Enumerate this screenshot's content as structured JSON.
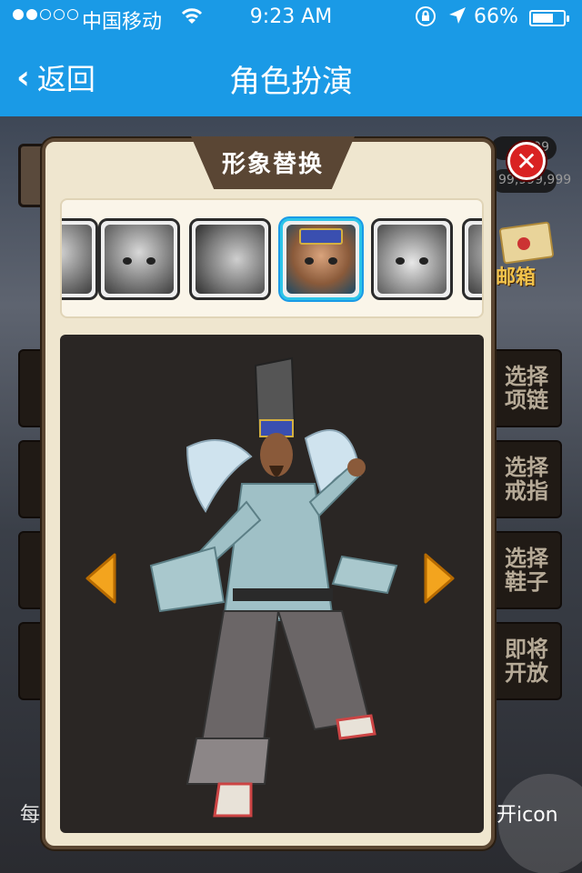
{
  "status_bar": {
    "signal_dots_on": 2,
    "signal_dots_total": 5,
    "carrier": "中国移动",
    "time": "9:23 AM",
    "battery_percent": "66%",
    "battery_level": 0.66
  },
  "nav": {
    "back_label": "返回",
    "title": "角色扮演"
  },
  "background": {
    "stat_values": [
      "999",
      "99,999,999"
    ],
    "mail_label": "邮箱",
    "side_buttons": [
      "选择\n项链",
      "选择\n戒指",
      "选择\n鞋子",
      "即将\n开放"
    ],
    "footer_left": "每",
    "footer_right": "开icon"
  },
  "dialog": {
    "title": "形象替换",
    "close_symbol": "✕",
    "thumbnails": [
      {
        "name": "partial-left"
      },
      {
        "name": "cartoon-girl"
      },
      {
        "name": "old-man-profile"
      },
      {
        "name": "warrior-blue-hat",
        "selected": true
      },
      {
        "name": "masked-woman"
      },
      {
        "name": "partial-right"
      }
    ]
  },
  "colors": {
    "nav_blue": "#1a9ae6",
    "dialog_bg": "#efe6cf",
    "dialog_header": "#5a4634",
    "close_red": "#d92222",
    "selected_cyan": "#2cc4e8",
    "arrow_orange": "#f3a41e"
  }
}
